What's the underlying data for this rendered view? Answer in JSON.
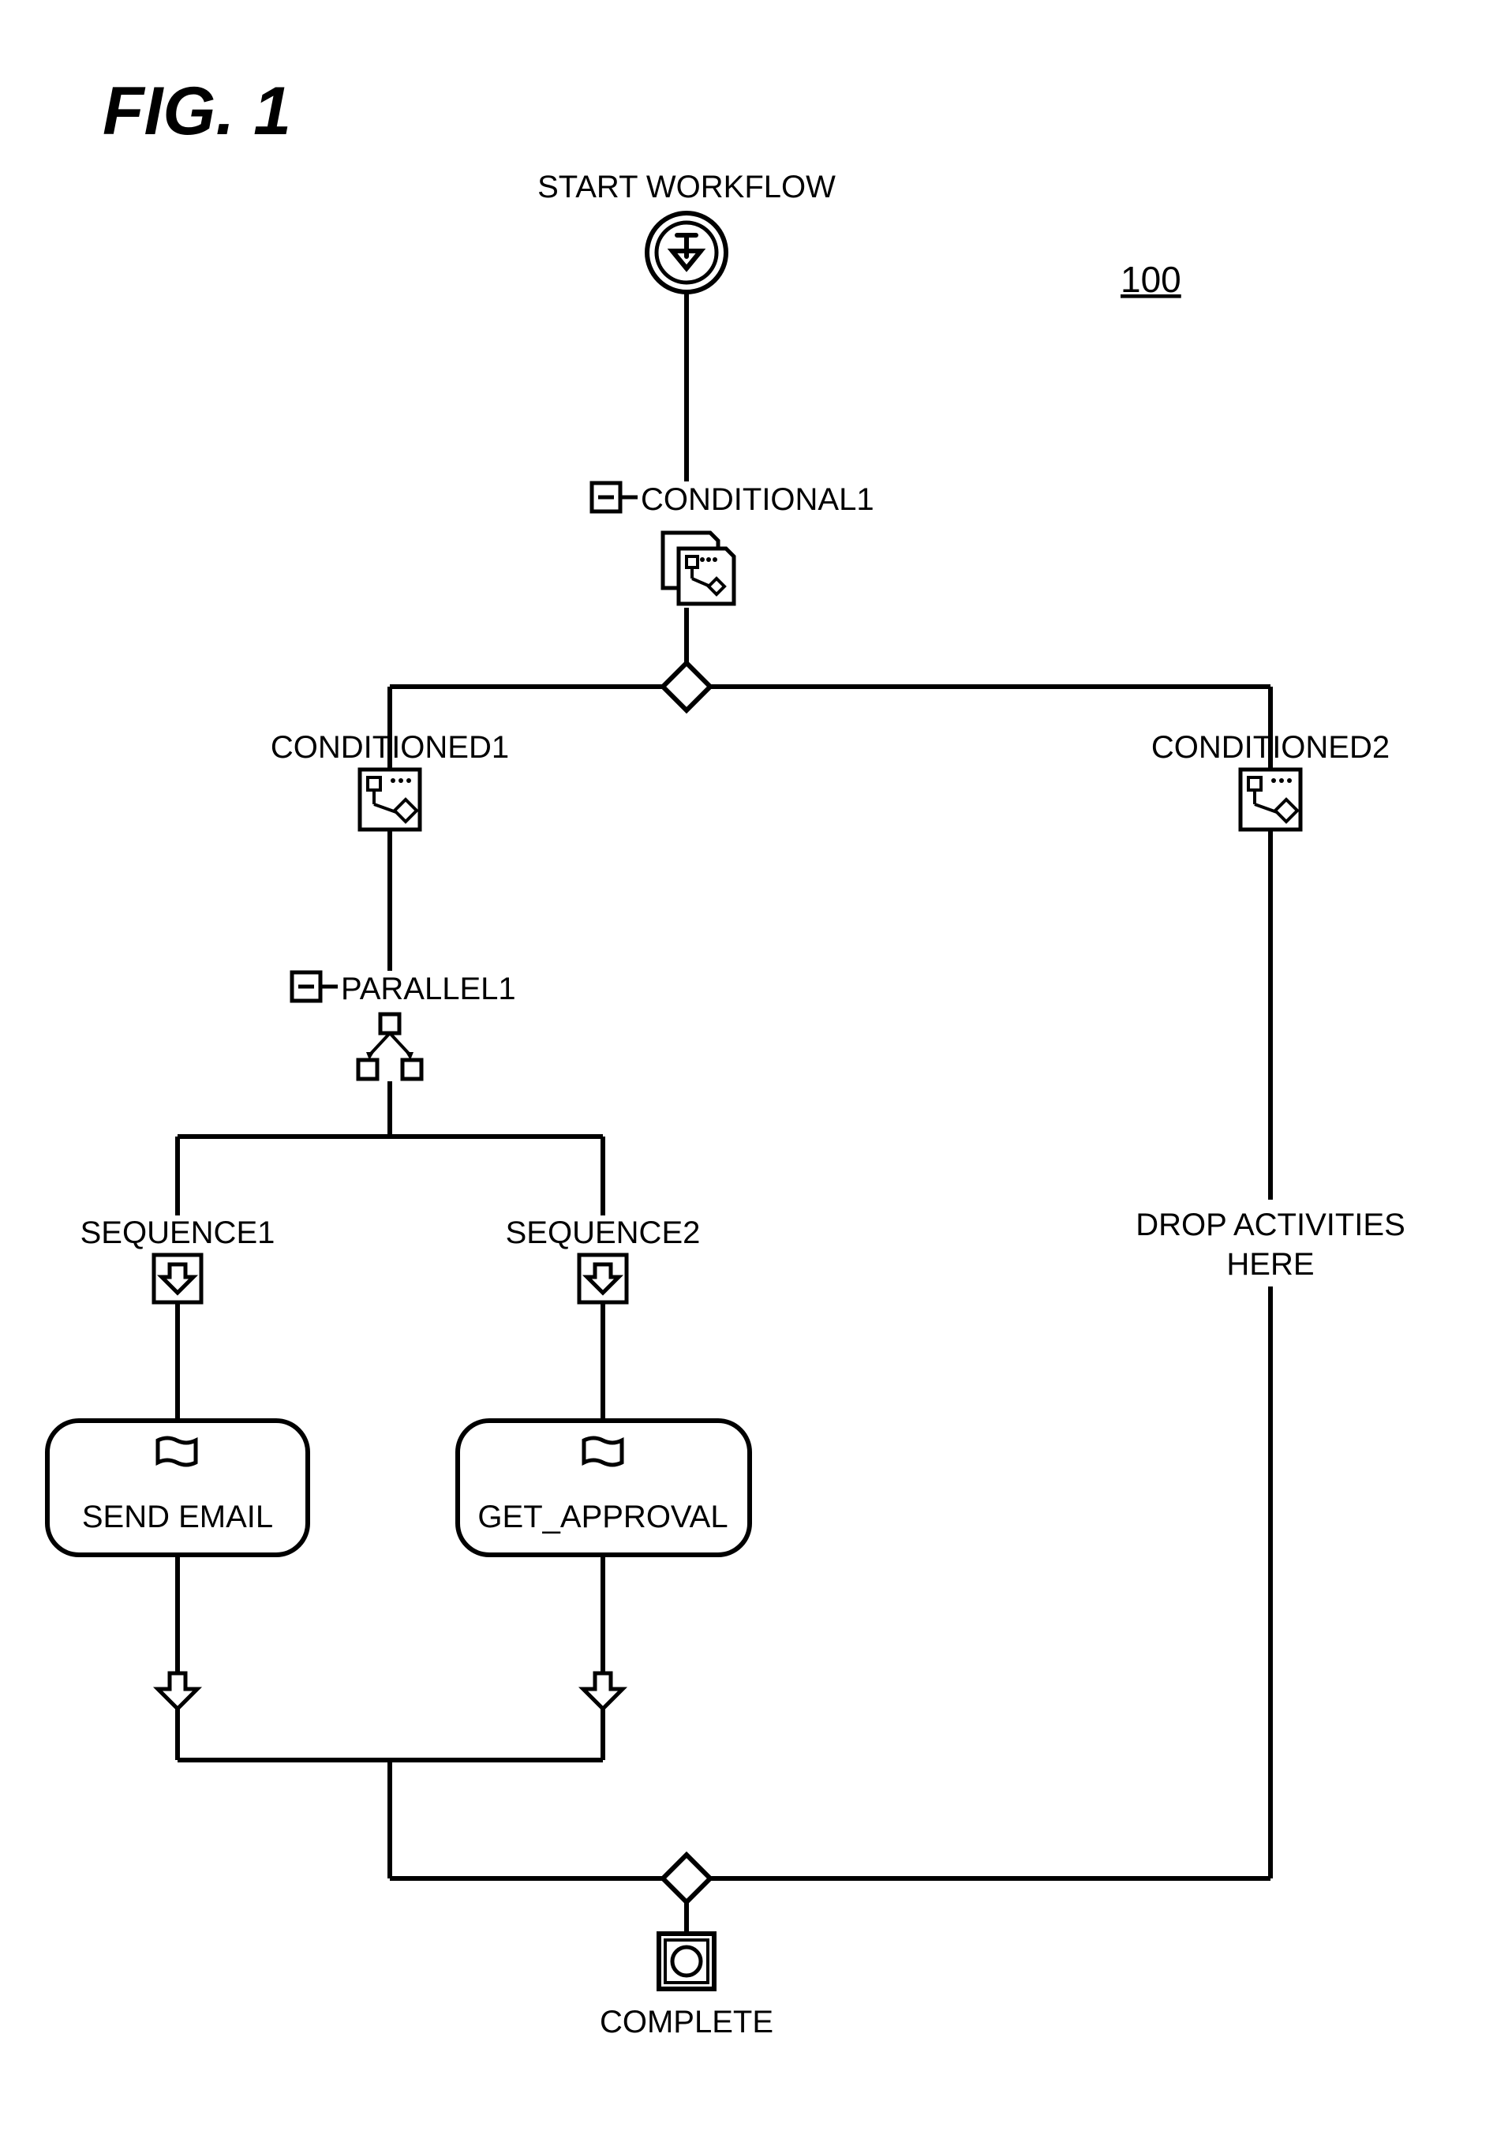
{
  "figure_label": "FIG. 1",
  "reference_number": "100",
  "nodes": {
    "start": "START WORKFLOW",
    "conditional1": "CONDITIONAL1",
    "conditioned1": "CONDITIONED1",
    "conditioned2": "CONDITIONED2",
    "parallel1": "PARALLEL1",
    "sequence1": "SEQUENCE1",
    "sequence2": "SEQUENCE2",
    "activity1": "SEND EMAIL",
    "activity2": "GET_APPROVAL",
    "drop_text_line1": "DROP ACTIVITIES",
    "drop_text_line2": "HERE",
    "complete": "COMPLETE"
  }
}
